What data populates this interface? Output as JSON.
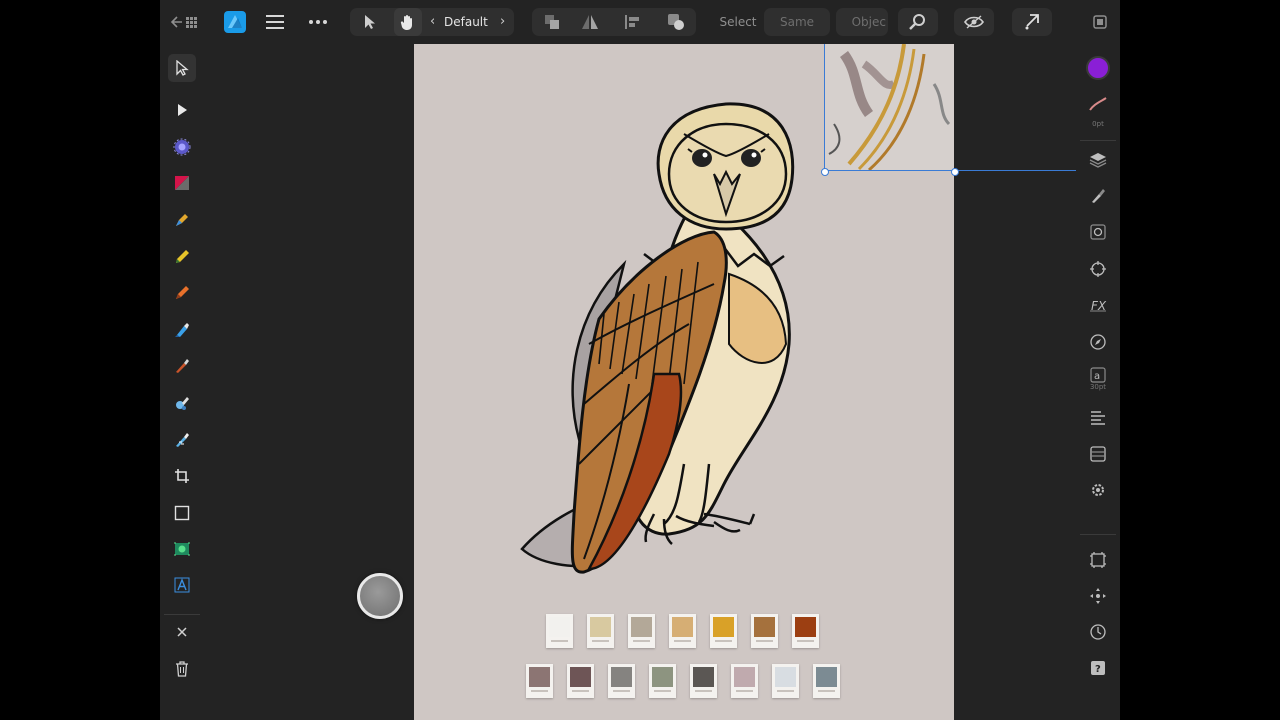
{
  "toolbar": {
    "persona_label": "Default",
    "select_label": "Select",
    "same_label": "Same",
    "object_label": "Objec"
  },
  "right_panel": {
    "brush_size": "0pt",
    "font_size": "30pt"
  },
  "colors": {
    "primary_color": "#8a1fd6",
    "accent": "#1a9be8",
    "selection": "#3a7bd5"
  },
  "swatches_row1": [
    "#f2f1ee",
    "#d8c9a0",
    "#b3a898",
    "#d6ae74",
    "#d9a128",
    "#a5713d",
    "#9c3f12"
  ],
  "swatches_row2": [
    "#8c7573",
    "#6e5556",
    "#858380",
    "#8d9480",
    "#5b5754",
    "#c0aaae",
    "#d8dde2",
    "#7c8b93"
  ]
}
